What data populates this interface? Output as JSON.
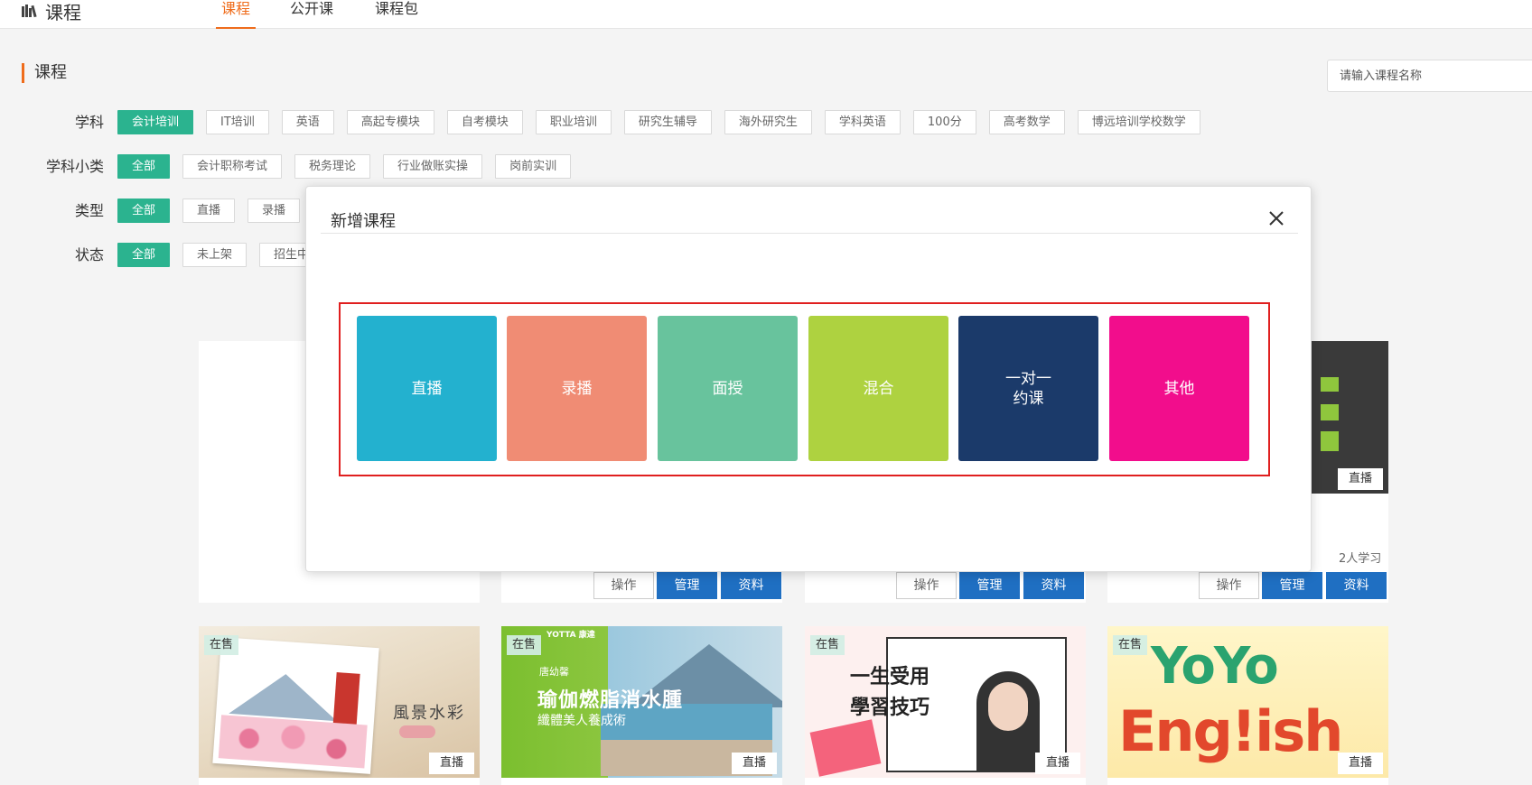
{
  "header": {
    "logo_text": "课程",
    "tabs": [
      "课程",
      "公开课",
      "课程包"
    ]
  },
  "filters": {
    "section_title": "课程",
    "search_placeholder": "请输入课程名称",
    "rows": [
      {
        "label": "学科",
        "options": [
          "会计培训",
          "IT培训",
          "英语",
          "高起专模块",
          "自考模块",
          "职业培训",
          "研究生辅导",
          "海外研究生",
          "学科英语",
          "100分",
          "高考数学",
          "博远培训学校数学"
        ],
        "active": 0
      },
      {
        "label": "学科小类",
        "options": [
          "全部",
          "会计职称考试",
          "税务理论",
          "行业做账实操",
          "岗前实训"
        ],
        "active": 0
      },
      {
        "label": "类型",
        "options": [
          "全部",
          "直播",
          "录播"
        ],
        "active": 0
      },
      {
        "label": "状态",
        "options": [
          "全部",
          "未上架",
          "招生中"
        ],
        "active": 0
      }
    ]
  },
  "modal": {
    "title": "新增课程",
    "types": [
      {
        "label": "直播",
        "color": "#23b1cf"
      },
      {
        "label": "录播",
        "color": "#f08c74"
      },
      {
        "label": "面授",
        "color": "#68c39d"
      },
      {
        "label": "混合",
        "color": "#aed240"
      },
      {
        "label": "一对一\n约课",
        "color": "#1b3a6a"
      },
      {
        "label": "其他",
        "color": "#f20d8c"
      }
    ]
  },
  "course_cards": {
    "row1": {
      "buttons": {
        "op": "操作",
        "manage": "管理",
        "material": "资料"
      },
      "last_card": {
        "type_tag": "直播",
        "learners": "2人学习"
      }
    },
    "row2": [
      {
        "status": "在售",
        "type_tag": "直播",
        "title_lines": [
          "風景水彩"
        ]
      },
      {
        "status": "在售",
        "type_tag": "直播",
        "brand": "YOTTA 康達",
        "name": "唐幼馨",
        "title": "瑜伽燃脂消水腫",
        "subtitle": "纖體美人養成術"
      },
      {
        "status": "在售",
        "type_tag": "直播",
        "title_lines": [
          "一生受用",
          "學習技巧"
        ]
      },
      {
        "status": "在售",
        "type_tag": "直播",
        "title_lines": [
          "YoYo",
          "Eng!ish"
        ]
      }
    ]
  },
  "colors": {
    "accent": "#ef6c1b",
    "chip_active": "#2bb38f",
    "button_blue": "#1f6fc2",
    "highlight_box": "#e01f1f"
  }
}
